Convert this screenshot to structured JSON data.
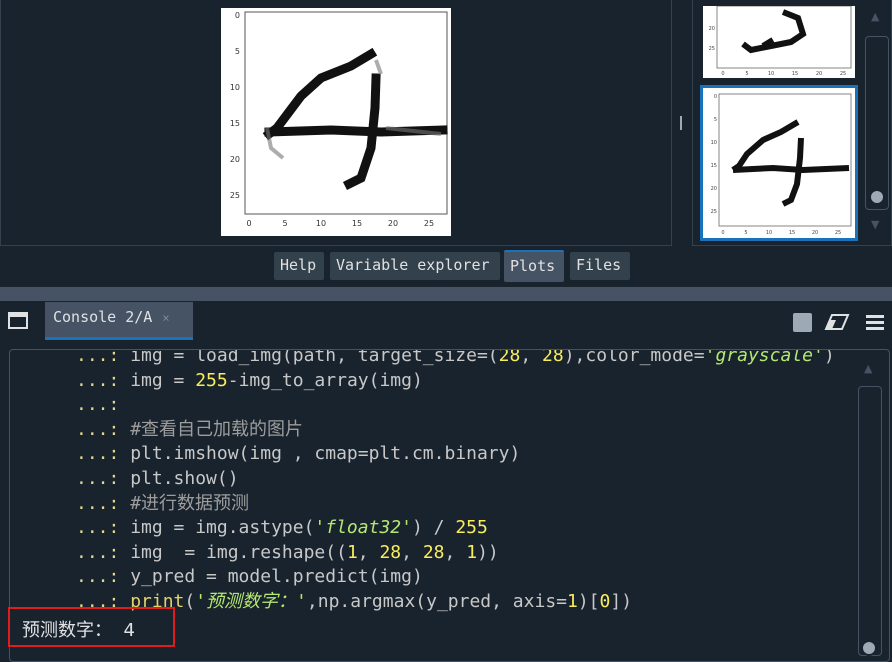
{
  "tabs": {
    "help": "Help",
    "variable_explorer": "Variable explorer",
    "plots": "Plots",
    "files": "Files"
  },
  "main_plot": {
    "y_ticks": [
      "0",
      "5",
      "10",
      "15",
      "20",
      "25"
    ],
    "x_ticks": [
      "0",
      "5",
      "10",
      "15",
      "20",
      "25"
    ],
    "digit": "4"
  },
  "thumbnails": [
    {
      "digit": "2",
      "y_ticks": [
        "20",
        "25"
      ],
      "x_ticks": [
        "0",
        "5",
        "10",
        "15",
        "20",
        "25"
      ]
    },
    {
      "digit": "4",
      "y_ticks": [
        "0",
        "5",
        "10",
        "15",
        "20",
        "25"
      ],
      "x_ticks": [
        "0",
        "5",
        "10",
        "15",
        "20",
        "25"
      ],
      "selected": true
    }
  ],
  "console": {
    "tab_label": "Console 2/A",
    "tab_close": "×",
    "lines": [
      {
        "prompt": "...:",
        "parts": [
          {
            "t": "img = load_img(path, target_size=(",
            "c": "kw"
          },
          {
            "t": "28",
            "c": "num"
          },
          {
            "t": ", ",
            "c": "kw"
          },
          {
            "t": "28",
            "c": "num"
          },
          {
            "t": "),color_mode=",
            "c": "kw"
          },
          {
            "t": "'grayscale'",
            "c": "str"
          },
          {
            "t": ")",
            "c": "kw"
          }
        ]
      },
      {
        "prompt": "...:",
        "parts": [
          {
            "t": "img = ",
            "c": "kw"
          },
          {
            "t": "255",
            "c": "num"
          },
          {
            "t": "-img_to_array(img)",
            "c": "kw"
          }
        ]
      },
      {
        "prompt": "...:",
        "parts": []
      },
      {
        "prompt": "...:",
        "parts": [
          {
            "t": "#查看自己加载的图片",
            "c": "cmt"
          }
        ]
      },
      {
        "prompt": "...:",
        "parts": [
          {
            "t": "plt.imshow(img , cmap=plt.cm.binary)",
            "c": "kw"
          }
        ]
      },
      {
        "prompt": "...:",
        "parts": [
          {
            "t": "plt.show()",
            "c": "kw"
          }
        ]
      },
      {
        "prompt": "...:",
        "parts": [
          {
            "t": "#进行数据预测",
            "c": "cmt"
          }
        ]
      },
      {
        "prompt": "...:",
        "parts": [
          {
            "t": "img = img.astype(",
            "c": "kw"
          },
          {
            "t": "'float32'",
            "c": "str"
          },
          {
            "t": ") / ",
            "c": "kw"
          },
          {
            "t": "255",
            "c": "num"
          }
        ]
      },
      {
        "prompt": "...:",
        "parts": [
          {
            "t": "img  = img.reshape((",
            "c": "kw"
          },
          {
            "t": "1",
            "c": "num"
          },
          {
            "t": ", ",
            "c": "kw"
          },
          {
            "t": "28",
            "c": "num"
          },
          {
            "t": ", ",
            "c": "kw"
          },
          {
            "t": "28",
            "c": "num"
          },
          {
            "t": ", ",
            "c": "kw"
          },
          {
            "t": "1",
            "c": "num"
          },
          {
            "t": "))",
            "c": "kw"
          }
        ]
      },
      {
        "prompt": "...:",
        "parts": [
          {
            "t": "y_pred = model.predict(img)",
            "c": "kw"
          }
        ]
      },
      {
        "prompt": "...:",
        "parts": [
          {
            "t": "print",
            "c": "fn"
          },
          {
            "t": "(",
            "c": "kw"
          },
          {
            "t": "'预测数字：'",
            "c": "str"
          },
          {
            "t": ",np.argmax(y_pred, axis=",
            "c": "kw"
          },
          {
            "t": "1",
            "c": "num"
          },
          {
            "t": ")[",
            "c": "kw"
          },
          {
            "t": "0",
            "c": "num"
          },
          {
            "t": "])",
            "c": "kw"
          }
        ]
      }
    ],
    "output": "预测数字：  4"
  },
  "colors": {
    "background": "#19232d",
    "accent": "#1a72bb",
    "highlight_box": "#e01d1d"
  }
}
